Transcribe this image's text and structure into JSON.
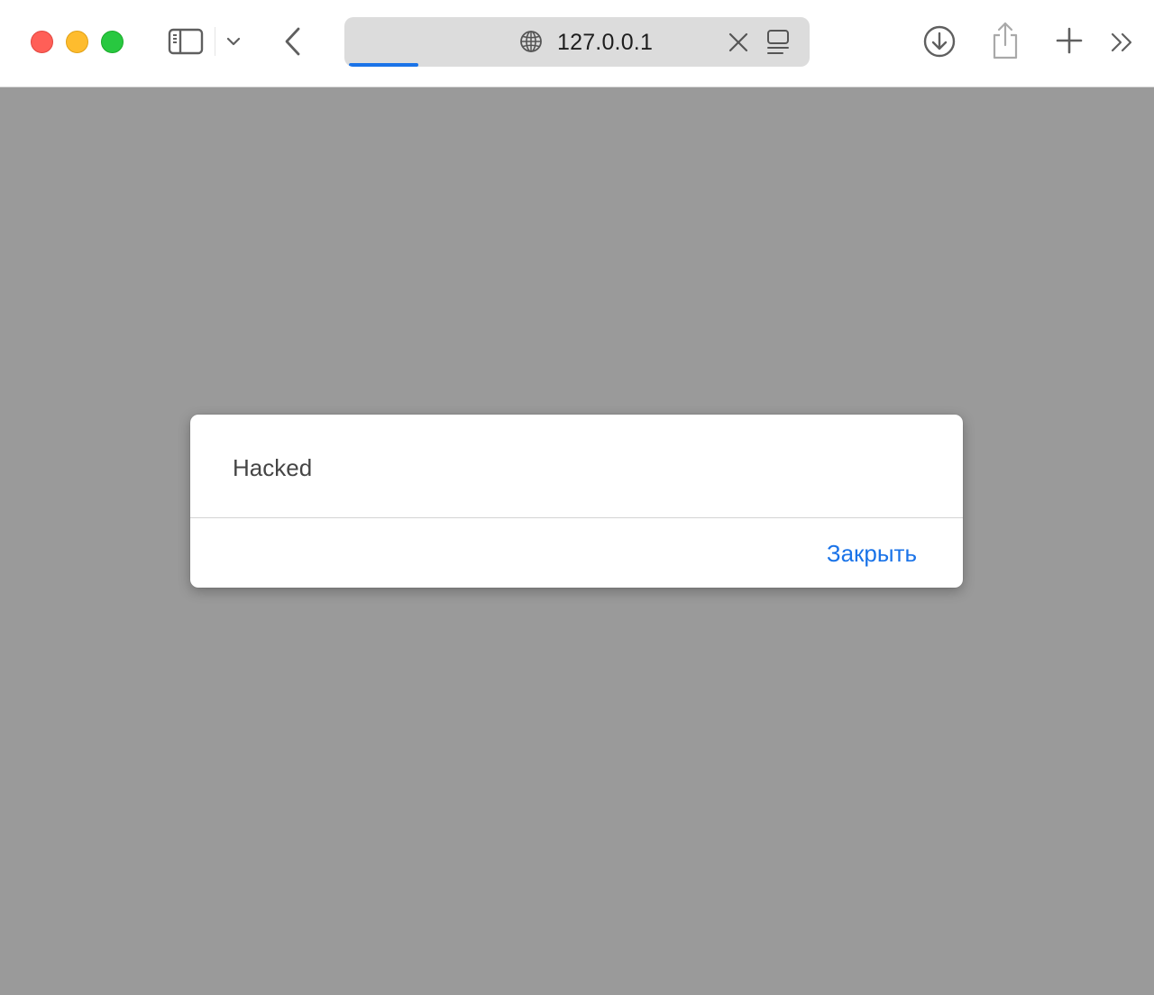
{
  "browser": {
    "address_bar": {
      "url": "127.0.0.1",
      "load_progress": 0.15
    },
    "icons": {
      "sidebar": "sidebar-icon",
      "sidebar_menu": "chevron-down-icon",
      "back": "chevron-left-icon",
      "site": "globe-icon",
      "clear": "close-icon",
      "reader": "reader-mode-icon",
      "downloads": "download-icon",
      "share": "share-icon",
      "new_tab": "plus-icon",
      "more": "double-chevron-right-icon"
    },
    "colors": {
      "close": "#ff5f57",
      "minimize": "#febc2e",
      "maximize": "#28c840",
      "accent": "#1a73e8",
      "backdrop": "#9a9a9a"
    }
  },
  "dialog": {
    "message": "Hacked",
    "close_label": "Закрыть"
  }
}
